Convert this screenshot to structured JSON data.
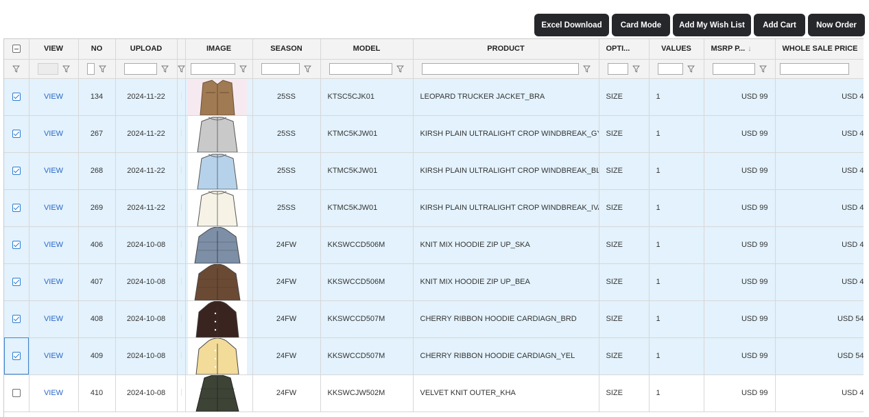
{
  "toolbar": {
    "excel_download": "Excel Download",
    "card_mode": "Card Mode",
    "add_wish_list": "Add My Wish List",
    "add_cart": "Add Cart",
    "now_order": "Now Order"
  },
  "columns": {
    "view": "VIEW",
    "no": "NO",
    "upload": "UPLOAD",
    "image": "IMAGE",
    "season": "SEASON",
    "model": "MODEL",
    "product": "PRODUCT",
    "options": "OPTI...",
    "values": "VALUES",
    "msrp": "MSRP P...",
    "msrp_sort": "↓",
    "wholesale": "WHOLE SALE PRICE"
  },
  "colors": {
    "accent": "#2a7bd2",
    "selected_row": "#e3f2fc",
    "button_bg": "#26272b",
    "link": "#2a67c9"
  },
  "rows": [
    {
      "selected": true,
      "view": "VIEW",
      "no": "134",
      "upload": "2024-11-22",
      "image_icon": "trucker-jacket-icon",
      "season": "25SS",
      "model": "KTSC5CJK01",
      "product": "LEOPARD TRUCKER JACKET_BRA",
      "option": "SIZE",
      "values": "1",
      "msrp": "USD 99",
      "wholesale": "USD 4"
    },
    {
      "selected": true,
      "view": "VIEW",
      "no": "267",
      "upload": "2024-11-22",
      "image_icon": "windbreaker-icon",
      "season": "25SS",
      "model": "KTMC5KJW01",
      "product": "KIRSH PLAIN ULTRALIGHT CROP WINDBREAK_GYA",
      "option": "SIZE",
      "values": "1",
      "msrp": "USD 99",
      "wholesale": "USD 4"
    },
    {
      "selected": true,
      "view": "VIEW",
      "no": "268",
      "upload": "2024-11-22",
      "image_icon": "windbreaker-icon",
      "season": "25SS",
      "model": "KTMC5KJW01",
      "product": "KIRSH PLAIN ULTRALIGHT CROP WINDBREAK_BLL",
      "option": "SIZE",
      "values": "1",
      "msrp": "USD 99",
      "wholesale": "USD 4"
    },
    {
      "selected": true,
      "view": "VIEW",
      "no": "269",
      "upload": "2024-11-22",
      "image_icon": "windbreaker-icon",
      "season": "25SS",
      "model": "KTMC5KJW01",
      "product": "KIRSH PLAIN ULTRALIGHT CROP WINDBREAK_IVA",
      "option": "SIZE",
      "values": "1",
      "msrp": "USD 99",
      "wholesale": "USD 4"
    },
    {
      "selected": true,
      "view": "VIEW",
      "no": "406",
      "upload": "2024-10-08",
      "image_icon": "hoodie-icon",
      "season": "24FW",
      "model": "KKSWCCD506M",
      "product": "KNIT MIX HOODIE ZIP UP_SKA",
      "option": "SIZE",
      "values": "1",
      "msrp": "USD 99",
      "wholesale": "USD 4"
    },
    {
      "selected": true,
      "view": "VIEW",
      "no": "407",
      "upload": "2024-10-08",
      "image_icon": "hoodie-icon",
      "season": "24FW",
      "model": "KKSWCCD506M",
      "product": "KNIT MIX HOODIE ZIP UP_BEA",
      "option": "SIZE",
      "values": "1",
      "msrp": "USD 99",
      "wholesale": "USD 4"
    },
    {
      "selected": true,
      "view": "VIEW",
      "no": "408",
      "upload": "2024-10-08",
      "image_icon": "cardigan-icon",
      "season": "24FW",
      "model": "KKSWCCD507M",
      "product": "CHERRY RIBBON HOODIE CARDIAGN_BRD",
      "option": "SIZE",
      "values": "1",
      "msrp": "USD 99",
      "wholesale": "USD 54"
    },
    {
      "selected": true,
      "focused": true,
      "view": "VIEW",
      "no": "409",
      "upload": "2024-10-08",
      "image_icon": "cardigan-icon",
      "season": "24FW",
      "model": "KKSWCCD507M",
      "product": "CHERRY RIBBON HOODIE CARDIAGN_YEL",
      "option": "SIZE",
      "values": "1",
      "msrp": "USD 99",
      "wholesale": "USD 54"
    },
    {
      "selected": false,
      "view": "VIEW",
      "no": "410",
      "upload": "2024-10-08",
      "image_icon": "knit-outer-icon",
      "season": "24FW",
      "model": "KKSWCJW502M",
      "product": "VELVET KNIT OUTER_KHA",
      "option": "SIZE",
      "values": "1",
      "msrp": "USD 99",
      "wholesale": "USD 4"
    }
  ]
}
